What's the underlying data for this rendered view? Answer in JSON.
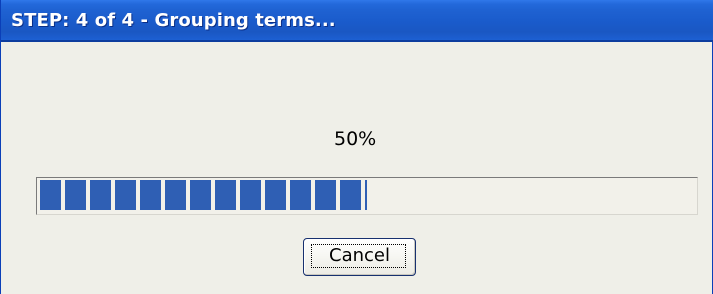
{
  "window": {
    "title": "STEP: 4 of 4 - Grouping terms..."
  },
  "progress": {
    "percent_text": "50%",
    "value": 0.5
  },
  "buttons": {
    "cancel_label": "Cancel"
  },
  "colors": {
    "titlebar": "#1a5bcb",
    "progress_block": "#2f5fb4",
    "window_background": "#efefe8"
  }
}
